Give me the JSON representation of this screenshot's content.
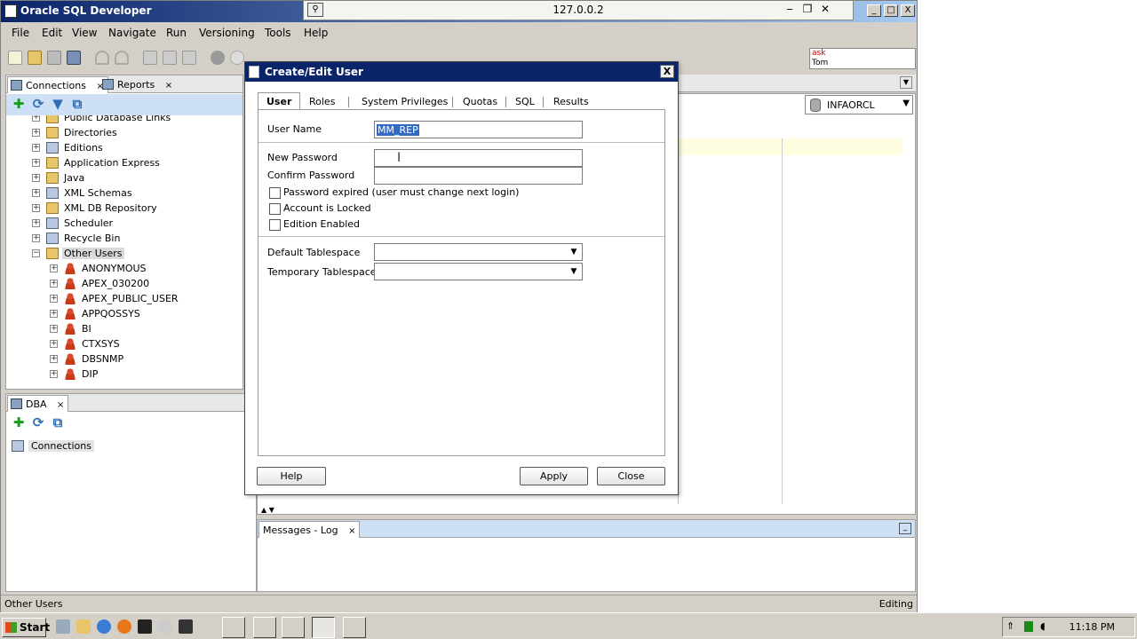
{
  "app": {
    "title": "Oracle SQL Developer",
    "remote_host": "127.0.0.2",
    "minimize_glyph": "_",
    "maximize_glyph": "□",
    "close_glyph": "X",
    "rdp_restore_glyph": "❐",
    "rdp_minimize_glyph": "‒",
    "rdp_close_glyph": "✕"
  },
  "menu": [
    "File",
    "Edit",
    "View",
    "Navigate",
    "Run",
    "Versioning",
    "Tools",
    "Help"
  ],
  "ask_box": {
    "line1": "ask",
    "line2": "Tom"
  },
  "left_pane": {
    "tabs": [
      {
        "label": "Connections",
        "close": "×"
      },
      {
        "label": "Reports",
        "close": "×"
      }
    ],
    "tree": [
      {
        "label": "Public Database Links",
        "icon": "folder-icon",
        "exp": "+",
        "level": 1
      },
      {
        "label": "Directories",
        "icon": "folder-icon",
        "exp": "+",
        "level": 1
      },
      {
        "label": "Editions",
        "icon": "gen-icon",
        "exp": "+",
        "level": 1
      },
      {
        "label": "Application Express",
        "icon": "folder-icon",
        "exp": "+",
        "level": 1
      },
      {
        "label": "Java",
        "icon": "folder-icon",
        "exp": "+",
        "level": 1
      },
      {
        "label": "XML Schemas",
        "icon": "gen-icon",
        "exp": "+",
        "level": 1
      },
      {
        "label": "XML DB Repository",
        "icon": "folder-icon",
        "exp": "+",
        "level": 1
      },
      {
        "label": "Scheduler",
        "icon": "gen-icon",
        "exp": "+",
        "level": 1
      },
      {
        "label": "Recycle Bin",
        "icon": "gen-icon",
        "exp": "+",
        "level": 1
      },
      {
        "label": "Other Users",
        "icon": "folder-icon",
        "exp": "−",
        "level": 1,
        "selected": true
      },
      {
        "label": "ANONYMOUS",
        "icon": "user-icon",
        "exp": "+",
        "level": 2
      },
      {
        "label": "APEX_030200",
        "icon": "user-icon",
        "exp": "+",
        "level": 2
      },
      {
        "label": "APEX_PUBLIC_USER",
        "icon": "user-icon",
        "exp": "+",
        "level": 2
      },
      {
        "label": "APPQOSSYS",
        "icon": "user-icon",
        "exp": "+",
        "level": 2
      },
      {
        "label": "BI",
        "icon": "user-icon",
        "exp": "+",
        "level": 2
      },
      {
        "label": "CTXSYS",
        "icon": "user-icon",
        "exp": "+",
        "level": 2
      },
      {
        "label": "DBSNMP",
        "icon": "user-icon",
        "exp": "+",
        "level": 2
      },
      {
        "label": "DIP",
        "icon": "user-icon",
        "exp": "+",
        "level": 2
      }
    ]
  },
  "dba_pane": {
    "tab": {
      "label": "DBA",
      "close": "×"
    },
    "root": "Connections"
  },
  "editor": {
    "connection": "INFAORCL",
    "scroll_up": "▲",
    "scroll_down": "▼"
  },
  "messages": {
    "tab": "Messages - Log",
    "close": "×"
  },
  "status": {
    "left": "Other Users",
    "right": "Editing"
  },
  "dialog": {
    "title": "Create/Edit User",
    "close_glyph": "X",
    "tabs": [
      "User",
      "Roles",
      "System Privileges",
      "Quotas",
      "SQL",
      "Results"
    ],
    "active_tab": "User",
    "fields": {
      "user_name_label": "User Name",
      "user_name_value": "MM_REP",
      "new_password_label": "New Password",
      "new_password_value": "",
      "confirm_password_label": "Confirm Password",
      "confirm_password_value": ""
    },
    "checkboxes": [
      {
        "label": "Password expired (user must change next login)",
        "checked": false
      },
      {
        "label": "Account is Locked",
        "checked": false
      },
      {
        "label": "Edition Enabled",
        "checked": false
      }
    ],
    "tablespaces": {
      "default_label": "Default Tablespace",
      "default_value": "",
      "temporary_label": "Temporary Tablespace",
      "temporary_value": ""
    },
    "buttons": {
      "help": "Help",
      "apply": "Apply",
      "close": "Close"
    }
  },
  "taskbar": {
    "start": "Start",
    "clock": "11:18 PM"
  },
  "colors": {
    "title_blue": "#0a246a",
    "selection_blue": "#316ac5",
    "pane_tool_bg": "#cde0f5",
    "window_gray": "#d4d0c8"
  }
}
